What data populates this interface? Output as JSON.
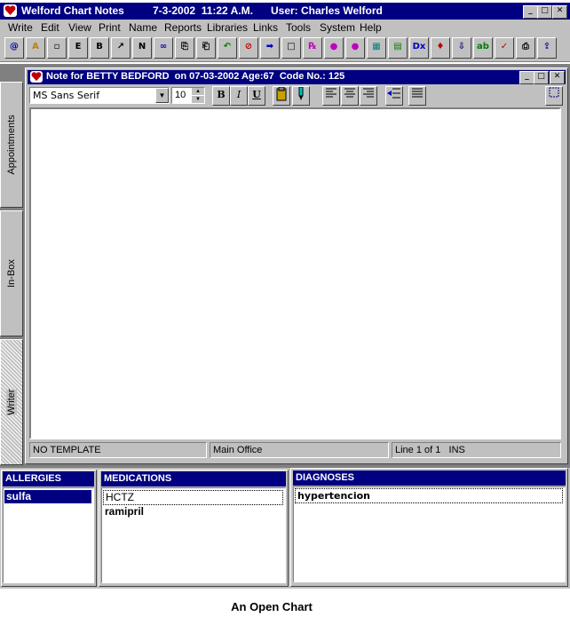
{
  "app": {
    "title": "Welford Chart Notes",
    "datetime": "7-3-2002  11:22 A.M.",
    "user": "User: Charles Welford"
  },
  "menu": [
    "Write",
    "Edit",
    "View",
    "Print",
    "Name",
    "Reports",
    "Libraries",
    "Links",
    "Tools",
    "System",
    "Help"
  ],
  "toolbar": {
    "icons": [
      {
        "name": "email-icon",
        "glyph": "@"
      },
      {
        "name": "font-icon",
        "glyph": "A"
      },
      {
        "name": "small-box-icon",
        "glyph": "▫"
      },
      {
        "name": "e-icon",
        "glyph": "E"
      },
      {
        "name": "b-icon",
        "glyph": "B"
      },
      {
        "name": "chart-icon",
        "glyph": "↗"
      },
      {
        "name": "n-icon",
        "glyph": "N"
      },
      {
        "name": "link-icon",
        "glyph": "∞"
      },
      {
        "name": "copy-icon",
        "glyph": "⎘"
      },
      {
        "name": "paste-icon",
        "glyph": "⎗"
      },
      {
        "name": "undo-icon",
        "glyph": "↶"
      },
      {
        "name": "no-entry-icon",
        "glyph": "⊘"
      },
      {
        "name": "import-icon",
        "glyph": "➡"
      },
      {
        "name": "blank-page-icon",
        "glyph": "□"
      },
      {
        "name": "rx-icon",
        "glyph": "℞"
      },
      {
        "name": "pill-icon",
        "glyph": "●"
      },
      {
        "name": "med-list-icon",
        "glyph": "●"
      },
      {
        "name": "calendar-icon",
        "glyph": "▦"
      },
      {
        "name": "document-add-icon",
        "glyph": "▤"
      },
      {
        "name": "dx-icon",
        "glyph": "Dx"
      },
      {
        "name": "lab-icon",
        "glyph": "♦"
      },
      {
        "name": "download-icon",
        "glyph": "⇩"
      },
      {
        "name": "ab-icon",
        "glyph": "ab"
      },
      {
        "name": "spellcheck-icon",
        "glyph": "✓"
      },
      {
        "name": "print-icon",
        "glyph": "⎙"
      },
      {
        "name": "export-icon",
        "glyph": "⇪"
      }
    ]
  },
  "note_window": {
    "title": "Note for BETTY BEDFORD  on 07-03-2002 Age:67  Code No.: 125",
    "font_name": "MS Sans Serif",
    "font_size": "10",
    "bold_label": "B",
    "italic_label": "I",
    "underline_label": "U",
    "status": {
      "template": "NO TEMPLATE",
      "location": "Main Office",
      "position": "Line 1 of 1   INS"
    }
  },
  "side_tabs": [
    "Appointments",
    "In-Box",
    "Writer"
  ],
  "allergies": {
    "title": "ALLERGIES",
    "items": [
      "sulfa"
    ]
  },
  "medications": {
    "title": "MEDICATIONS",
    "items": [
      "HCTZ",
      "ramipril"
    ]
  },
  "diagnoses": {
    "title": "DIAGNOSES",
    "items": [
      "hypertencion"
    ]
  },
  "caption": "An Open Chart"
}
